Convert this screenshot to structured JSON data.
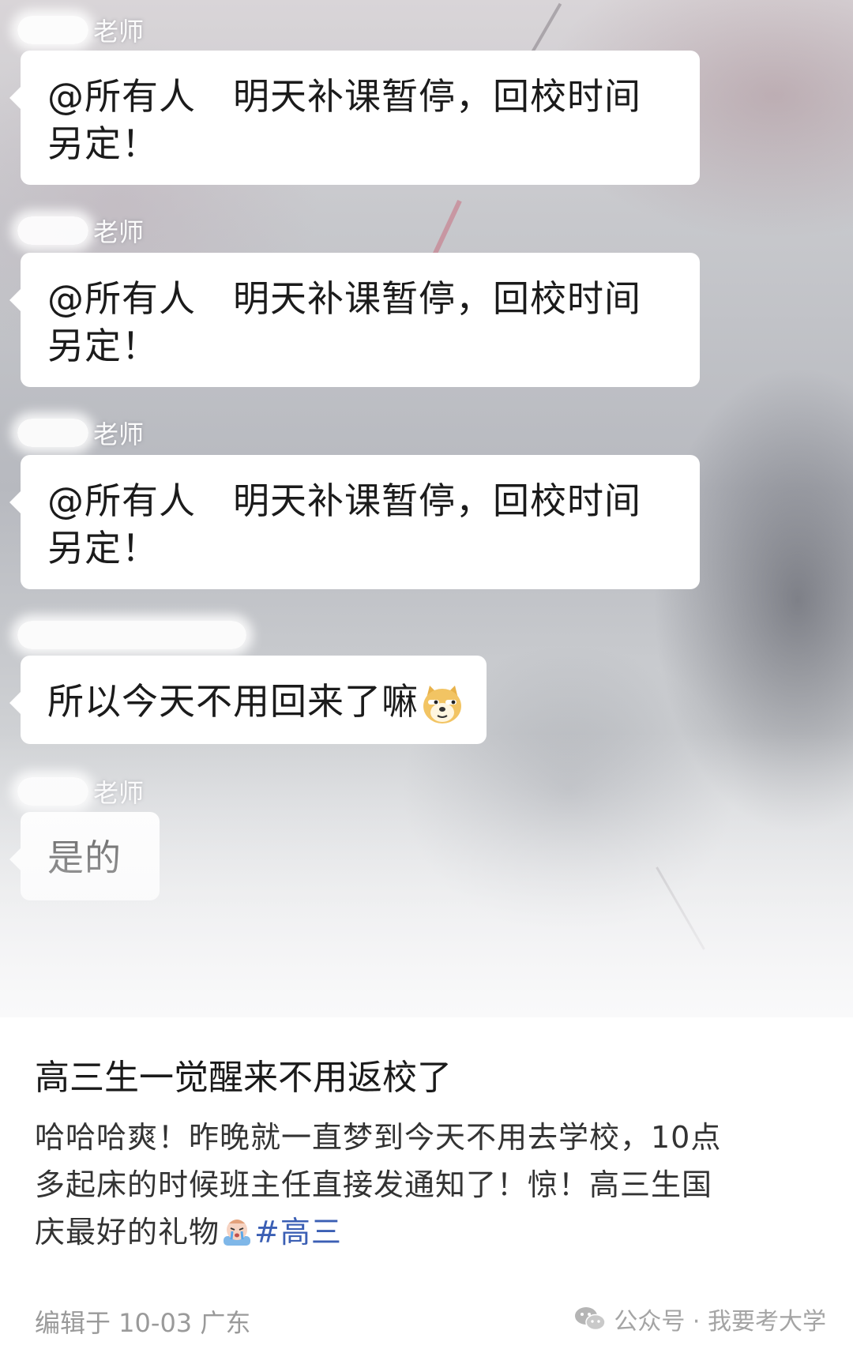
{
  "chat": {
    "messages": [
      {
        "sender_suffix": "老师",
        "lines": [
          "@所有人　明天补课暂停，回校时间",
          "另定！"
        ]
      },
      {
        "sender_suffix": "老师",
        "lines": [
          "@所有人　明天补课暂停，回校时间",
          "另定！"
        ]
      },
      {
        "sender_suffix": "老师",
        "lines": [
          "@所有人　明天补课暂停，回校时间",
          "另定！"
        ]
      },
      {
        "sender_suffix": "",
        "lines": [
          "所以今天不用回来了嘛"
        ],
        "emoji": "doge-emoji"
      },
      {
        "sender_suffix": "老师",
        "lines": [
          "是的"
        ]
      }
    ]
  },
  "post": {
    "title": "高三生一觉醒来不用返校了",
    "body_lines": [
      "哈哈哈爽！昨晚就一直梦到今天不用去学校，10点",
      "多起床的时候班主任直接发通知了！惊！高三生国",
      "庆最好的礼物"
    ],
    "body_emoji": "crying-emoji",
    "hashtag": "#高三",
    "meta": "编辑于 10-03 广东",
    "watermark": "公众号 · 我要考大学"
  },
  "colors": {
    "hashtag": "#3b5fb4",
    "meta": "#9a9a9a"
  }
}
